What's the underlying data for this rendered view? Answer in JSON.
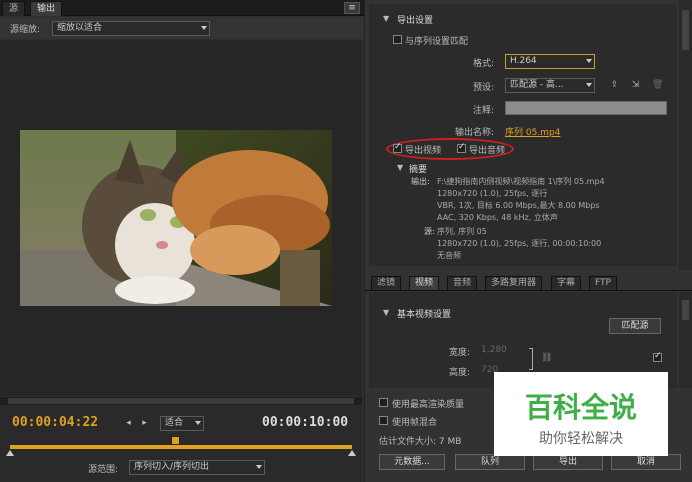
{
  "tabs": {
    "source": "源",
    "output": "输出"
  },
  "scale": {
    "label": "源缩放:",
    "value": "缩放以适合"
  },
  "timecode": {
    "current": "00:00:04:22",
    "end": "00:00:10:00",
    "fit": "适合"
  },
  "range": {
    "label": "源范围:",
    "value": "序列切入/序列切出"
  },
  "export": {
    "section_title": "导出设置",
    "match_seq": "与序列设置匹配",
    "format_label": "格式:",
    "format_value": "H.264",
    "preset_label": "预设:",
    "preset_value": "匹配源 - 高...",
    "comment_label": "注释:",
    "output_name_label": "输出名称:",
    "output_name_value": "序列 05.mp4",
    "export_video": "导出视频",
    "export_audio": "导出音频",
    "summary_title": "摘要",
    "output_label": "输出:",
    "output_lines": [
      "F:\\捷狗指南内侧视频\\视频指南 1\\序列 05.mp4",
      "1280x720 (1.0), 25fps, 逐行",
      "VBR, 1次, 目标 6.00 Mbps,最大 8.00 Mbps",
      "AAC, 320 Kbps, 48 kHz, 立体声"
    ],
    "source_label": "源:",
    "source_lines": [
      "序列, 序列 05",
      "1280x720 (1.0), 25fps, 逐行, 00:00:10:00",
      "无音频"
    ]
  },
  "right_tabs": [
    "滤镜",
    "视频",
    "音频",
    "多路复用器",
    "字幕",
    "FTP"
  ],
  "video": {
    "section_title": "基本视频设置",
    "match_source": "匹配源",
    "width_label": "宽度:",
    "width_value": "1,280",
    "height_label": "高度:",
    "height_value": "720"
  },
  "bottom": {
    "max_render": "使用最高渲染质量",
    "use_blend": "使用帧混合",
    "est_size": "估计文件大小: 7 MB",
    "metadata": "元数据...",
    "queue": "队列",
    "export": "导出",
    "cancel": "取消"
  },
  "watermark": {
    "title": "百科全说",
    "subtitle": "助你轻松解决"
  },
  "colors": {
    "accent": "#e0a020",
    "highlight_ring": "#d02020",
    "watermark_green": "#3fae49"
  }
}
